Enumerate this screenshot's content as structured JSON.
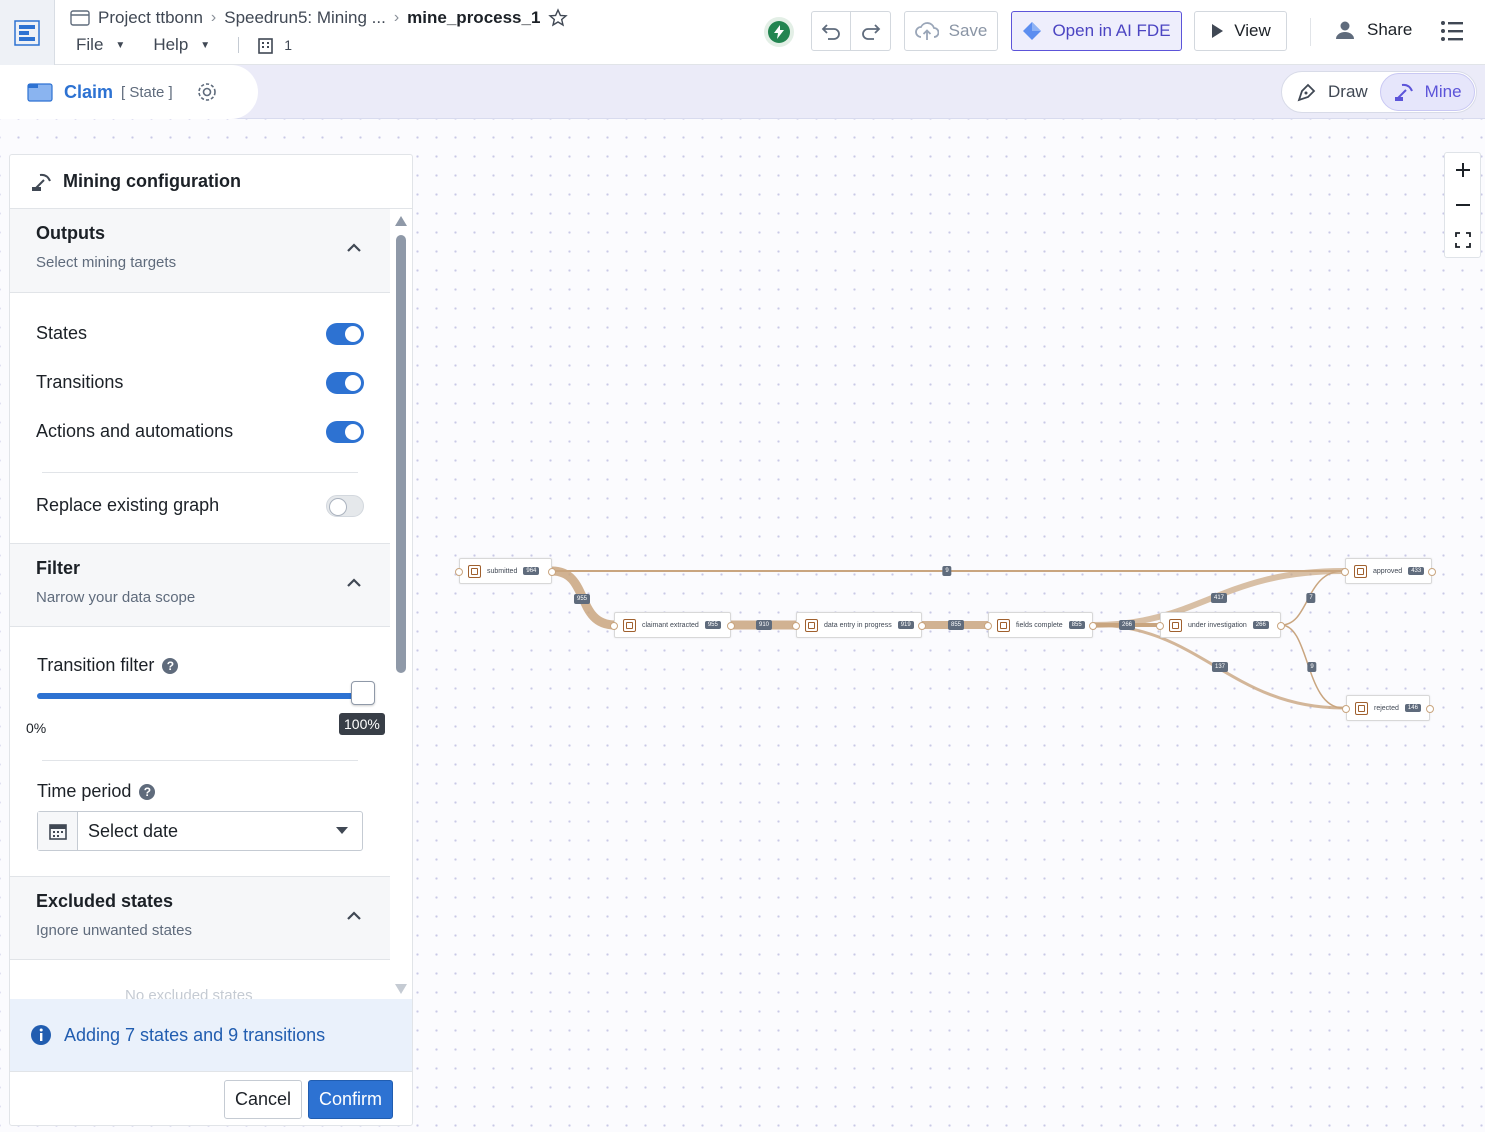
{
  "header": {
    "breadcrumb": [
      "Project ttbonn",
      "Speedrun5: Mining ...",
      "mine_process_1"
    ],
    "menu": [
      "File",
      "Help"
    ],
    "member_count": "1",
    "save_label": "Save",
    "open_label": "Open in AI FDE",
    "view_label": "View",
    "share_label": "Share"
  },
  "subbar": {
    "object_name": "Claim",
    "object_type": "[ State ]",
    "modes": [
      "Draw",
      "Mine"
    ],
    "active_mode": "Mine"
  },
  "panel": {
    "title": "Mining configuration",
    "outputs": {
      "title": "Outputs",
      "subtitle": "Select mining targets",
      "toggles": [
        {
          "label": "States",
          "on": true
        },
        {
          "label": "Transitions",
          "on": true
        },
        {
          "label": "Actions and automations",
          "on": true
        }
      ],
      "replace_label": "Replace existing graph",
      "replace_on": false
    },
    "filter": {
      "title": "Filter",
      "subtitle": "Narrow your data scope",
      "transition_filter_label": "Transition filter",
      "min_label": "0%",
      "value_label": "100%",
      "value": 1.0,
      "time_period_label": "Time period",
      "time_period_value": "Select date"
    },
    "excluded": {
      "title": "Excluded states",
      "subtitle": "Ignore unwanted states",
      "empty_text": "No excluded states"
    },
    "callout": "Adding 7 states and 9 transitions",
    "cancel_label": "Cancel",
    "confirm_label": "Confirm"
  },
  "graph": {
    "states": [
      {
        "name": "submitted",
        "count": "964"
      },
      {
        "name": "claimant extracted",
        "count": "955"
      },
      {
        "name": "data entry in progress",
        "count": "919"
      },
      {
        "name": "fields complete",
        "count": "855"
      },
      {
        "name": "under investigation",
        "count": "266"
      },
      {
        "name": "approved",
        "count": "433"
      },
      {
        "name": "rejected",
        "count": "146"
      }
    ],
    "transitions": [
      "9",
      "955",
      "910",
      "855",
      "266",
      "417",
      "137",
      "7",
      "9"
    ]
  },
  "colors": {
    "accent": "#2d72d2",
    "mine": "#5c54d9",
    "edge": "#c9a57f"
  }
}
